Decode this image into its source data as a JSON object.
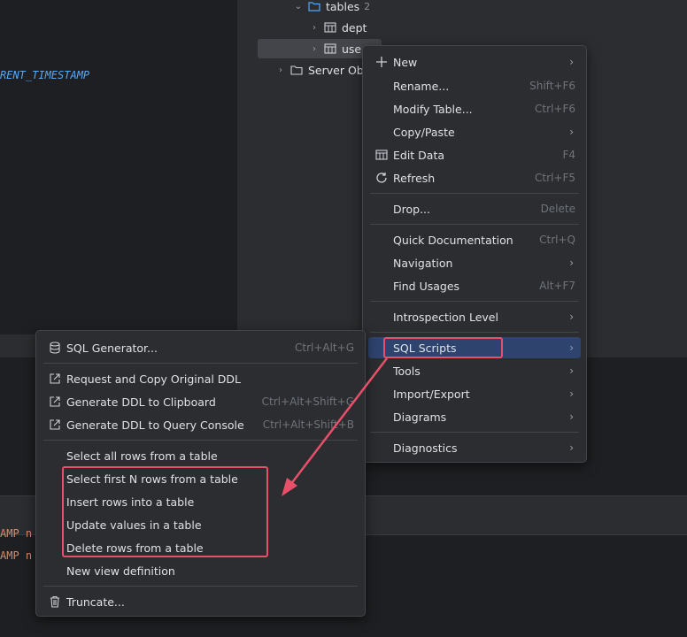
{
  "editor": {
    "code_line_1": "RENT_TIMESTAMP",
    "code_line_2": "AMP n",
    "code_line_3": "AMP n"
  },
  "tree": {
    "tables_label": "tables",
    "tables_count": "2",
    "dept_label": "dept",
    "user_label": "use",
    "server_objects_label": "Server Ob"
  },
  "context_menu": {
    "new": "New",
    "rename": "Rename...",
    "rename_shortcut": "Shift+F6",
    "modify_table": "Modify Table...",
    "modify_table_shortcut": "Ctrl+F6",
    "copy_paste": "Copy/Paste",
    "edit_data": "Edit Data",
    "edit_data_shortcut": "F4",
    "refresh": "Refresh",
    "refresh_shortcut": "Ctrl+F5",
    "drop": "Drop...",
    "drop_shortcut": "Delete",
    "quick_documentation": "Quick Documentation",
    "quick_documentation_shortcut": "Ctrl+Q",
    "navigation": "Navigation",
    "find_usages": "Find Usages",
    "find_usages_shortcut": "Alt+F7",
    "introspection_level": "Introspection Level",
    "sql_scripts": "SQL Scripts",
    "tools": "Tools",
    "import_export": "Import/Export",
    "diagrams": "Diagrams",
    "diagnostics": "Diagnostics"
  },
  "submenu": {
    "sql_generator": "SQL Generator...",
    "sql_generator_shortcut": "Ctrl+Alt+G",
    "request_copy_ddl": "Request and Copy Original DDL",
    "ddl_clipboard": "Generate DDL to Clipboard",
    "ddl_clipboard_shortcut": "Ctrl+Alt+Shift+G",
    "ddl_console": "Generate DDL to Query Console",
    "ddl_console_shortcut": "Ctrl+Alt+Shift+B",
    "select_all": "Select all rows from a table",
    "select_first_n": "Select first N rows from a table",
    "insert_rows": "Insert rows into a table",
    "update_values": "Update values in a table",
    "delete_rows": "Delete rows from a table",
    "new_view": "New view definition",
    "truncate": "Truncate..."
  },
  "colors": {
    "background": "#1e1f22",
    "panel": "#2b2d30",
    "highlight": "#2e436e",
    "annotation_red": "#e8506a"
  }
}
